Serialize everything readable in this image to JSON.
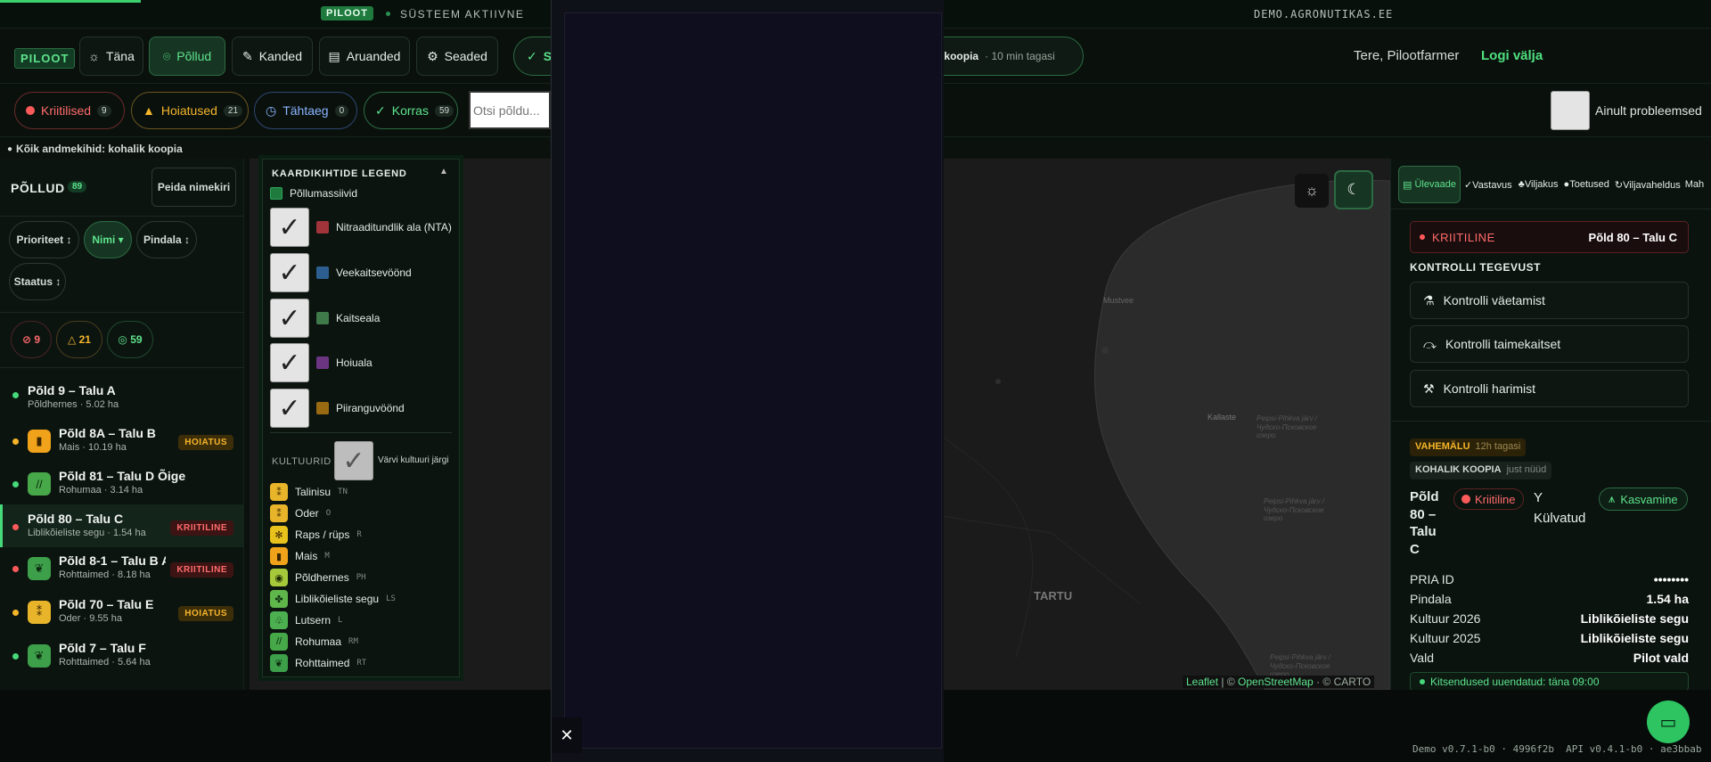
{
  "topbar": {
    "badge": "PILOOT",
    "status": "SÜSTEEM AKTIIVNE",
    "domain": "DEMO.AGRONUTIKAS.EE"
  },
  "nav": {
    "brand": "PILOOT",
    "items": [
      "Täna",
      "Põllud",
      "Kanded",
      "Aruanded",
      "Seaded"
    ],
    "sync_letter": "S",
    "sync_text": "alik koopia",
    "sync_time": "· 10 min tagasi",
    "greeting": "Tere, Pilootfarmer",
    "logout": "Logi välja"
  },
  "filters": {
    "critical": {
      "label": "Kriitilised",
      "count": "9"
    },
    "warnings": {
      "label": "Hoiatused",
      "count": "21"
    },
    "deadline": {
      "label": "Tähtaeg",
      "count": "0"
    },
    "ok": {
      "label": "Korras",
      "count": "59"
    },
    "search_placeholder": "Otsi põldu...",
    "only_problem": "Ainult probleemsed"
  },
  "datasource": "Kõik andmekihid: kohalik koopia",
  "sidebar": {
    "title": "PÕLLUD",
    "count": "89",
    "hide_btn": "Peida nimekiri",
    "sorts": [
      "Prioriteet ↕",
      "Nimi ▾",
      "Pindala ↕",
      "Staatus ↕"
    ],
    "summary": [
      "9",
      "21",
      "59"
    ],
    "fields": [
      {
        "name": "Põld 9 – Talu A",
        "sub": "Põldhernes · 5.02 ha",
        "status": "ok",
        "badge": "",
        "icon": ""
      },
      {
        "name": "Põld 8A – Talu B",
        "sub": "Mais · 10.19 ha",
        "status": "warn",
        "badge": "HOIATUS",
        "icon": "mais"
      },
      {
        "name": "Põld 81 – Talu D Õige",
        "sub": "Rohumaa · 3.14 ha",
        "status": "ok",
        "badge": "",
        "icon": "rohumaa"
      },
      {
        "name": "Põld 80 – Talu C",
        "sub": "Liblikõieliste segu · 1.54 ha",
        "status": "crit",
        "badge": "KRIITILINE",
        "icon": ""
      },
      {
        "name": "Põld 8-1 – Talu B Al",
        "sub": "Rohttaimed · 8.18 ha",
        "status": "crit",
        "badge": "KRIITILINE",
        "icon": "rohttaimed"
      },
      {
        "name": "Põld 70 – Talu E",
        "sub": "Oder · 9.55 ha",
        "status": "warn",
        "badge": "HOIATUS",
        "icon": "oder"
      },
      {
        "name": "Põld 7 – Talu F",
        "sub": "Rohttaimed · 5.64 ha",
        "status": "ok",
        "badge": "",
        "icon": "rohttaimed"
      }
    ]
  },
  "legend": {
    "title": "KAARDIKIHTIDE LEGEND",
    "base": "Põllumassiivid",
    "layers": [
      {
        "label": "Nitraaditundlik ala (NTA)",
        "color": "#a1333a"
      },
      {
        "label": "Veekaitsevöönd",
        "color": "#2c5f8f"
      },
      {
        "label": "Kaitseala",
        "color": "#3f7a4a"
      },
      {
        "label": "Hoiuala",
        "color": "#6b3582"
      },
      {
        "label": "Piiranguvöönd",
        "color": "#9a6a12"
      }
    ],
    "crops_title": "KULTUURID",
    "color_by": "Värvi kultuuri järgi",
    "crops": [
      {
        "name": "Talinisu",
        "code": "TN",
        "color": "#e8b52a"
      },
      {
        "name": "Oder",
        "code": "O",
        "color": "#e8b52a"
      },
      {
        "name": "Raps / rüps",
        "code": "R",
        "color": "#e8c21c"
      },
      {
        "name": "Mais",
        "code": "M",
        "color": "#f0a31a"
      },
      {
        "name": "Põldhernes",
        "code": "PH",
        "color": "#a5c93a"
      },
      {
        "name": "Liblikõieliste segu",
        "code": "LS",
        "color": "#5fb64a"
      },
      {
        "name": "Lutsern",
        "code": "L",
        "color": "#4caf50"
      },
      {
        "name": "Rohumaa",
        "code": "RM",
        "color": "#46a848"
      },
      {
        "name": "Rohttaimed",
        "code": "RT",
        "color": "#3d9f4a"
      }
    ]
  },
  "map": {
    "labels": [
      "Mustvee",
      "Kallaste",
      "Peipsi-Pihkva järv / Чудско-Псковское озеро",
      "Peipsi-Pihkva järv / Чудско-Псковское озеро",
      "Peipsi-Pihkva järv / Чудско-Псковское озеро",
      "TARTU"
    ],
    "attribution_leaflet": "Leaflet",
    "attribution_sep": "| ©",
    "attribution_osm": "OpenStreetMap",
    "attribution_carto": "· © CARTO"
  },
  "rpanel": {
    "tabs": [
      "Ülevaade",
      "Vastavus",
      "Viljakus",
      "Toetused",
      "Viljavaheldus",
      "Mah"
    ],
    "alert_level": "KRIITILINE",
    "alert_field": "Põld 80 – Talu C",
    "actions_title": "KONTROLLI TEGEVUST",
    "actions": [
      "Kontrolli väetamist",
      "Kontrolli taimekaitset",
      "Kontrolli harimist"
    ],
    "cache_label": "VAHEMÄLU",
    "cache_time": "12h tagasi",
    "local_label": "KOHALIK KOOPIA",
    "local_time": "just nüüd",
    "field_title": "Põld 80 – Talu C",
    "crit_pill": "Kriitiline",
    "y": "Y",
    "kylvatud": "Külvatud",
    "growth": "Kasvamine",
    "details": [
      {
        "k": "PRIA ID",
        "v": "••••••••"
      },
      {
        "k": "Pindala",
        "v": "1.54 ha"
      },
      {
        "k": "Kultuur 2026",
        "v": "Liblikõieliste segu"
      },
      {
        "k": "Kultuur 2025",
        "v": "Liblikõieliste segu"
      },
      {
        "k": "Vald",
        "v": "Pilot vald"
      }
    ],
    "restrictions": "Kitsendused uuendatud: täna 09:00"
  },
  "footer": {
    "version": "Demo v0.7.1-b0 · 4996f2b  API v0.4.1-b0 · ae3bbab"
  },
  "colors": {
    "accent": "#3ccf6e",
    "critical": "#ff5a5a",
    "warning": "#f5b52a",
    "ok": "#46d97a",
    "deadline": "#8ab4ff"
  }
}
